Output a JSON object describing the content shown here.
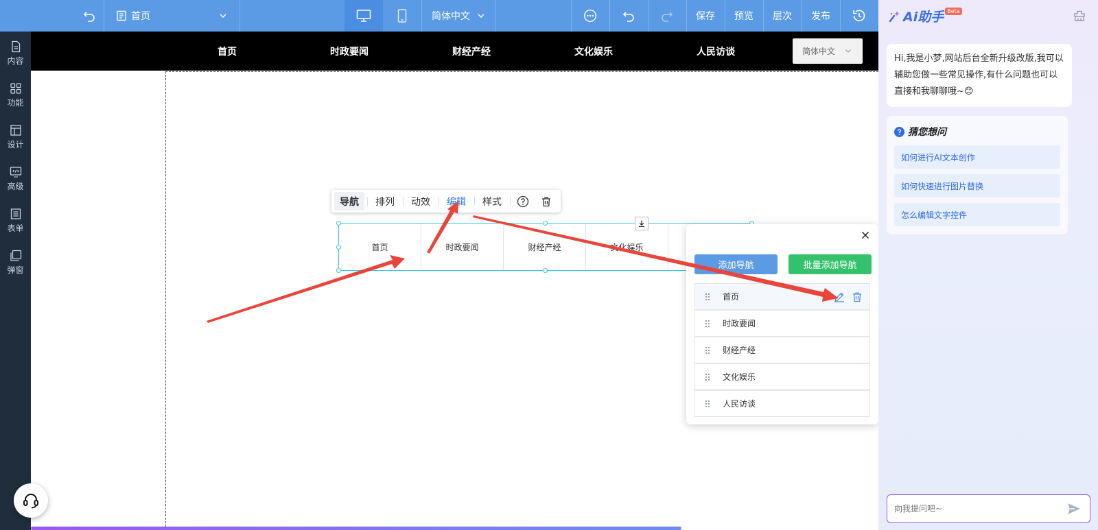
{
  "topbar": {
    "page_select": "首页",
    "lang_select": "简体中文",
    "save": "保存",
    "preview": "预览",
    "layers": "层次",
    "publish": "发布"
  },
  "sidebar": {
    "items": [
      {
        "label": "内容",
        "icon": "file-icon"
      },
      {
        "label": "功能",
        "icon": "grid-icon"
      },
      {
        "label": "设计",
        "icon": "layout-icon"
      },
      {
        "label": "高级",
        "icon": "code-monitor-icon"
      },
      {
        "label": "表单",
        "icon": "form-icon"
      },
      {
        "label": "弹窗",
        "icon": "popup-icon"
      }
    ]
  },
  "site_nav": {
    "links": [
      "首页",
      "时政要闻",
      "财经产经",
      "文化娱乐",
      "人民访谈"
    ],
    "lang": "简体中文"
  },
  "toolbar": {
    "items": [
      "导航",
      "排列",
      "动效",
      "编辑",
      "样式"
    ],
    "active": "编辑",
    "colors": {
      "active": "#2e7be6"
    }
  },
  "nav_widget": {
    "items": [
      "首页",
      "时政要闻",
      "财经产经",
      "文化娱乐"
    ]
  },
  "edit_panel": {
    "add_nav": "添加导航",
    "batch_add_nav": "批量添加导航",
    "items": [
      "首页",
      "时政要闻",
      "财经产经",
      "文化娱乐",
      "人民访谈"
    ],
    "colors": {
      "add": "#5b9be6",
      "batch": "#33c26b"
    }
  },
  "ai": {
    "title": "Ai助手",
    "badge": "Beta",
    "greeting": "Hi,我是小梦,网站后台全新升级改版,我可以辅助您做一些常见操作,有什么问题也可以直接和我聊聊哦~😊",
    "guess_title": "猜您想问",
    "suggestions": [
      "如何进行AI文本创作",
      "如何快速进行图片替换",
      "怎么编辑文字控件"
    ],
    "input_placeholder": "向我提问吧~",
    "colors": {
      "accent": "#2e6be6",
      "input_border": "#8b5cf6"
    }
  },
  "colors": {
    "topbar": "#5b9be6",
    "sidebar": "#1f2d3d",
    "arrow": "#e8453c"
  }
}
